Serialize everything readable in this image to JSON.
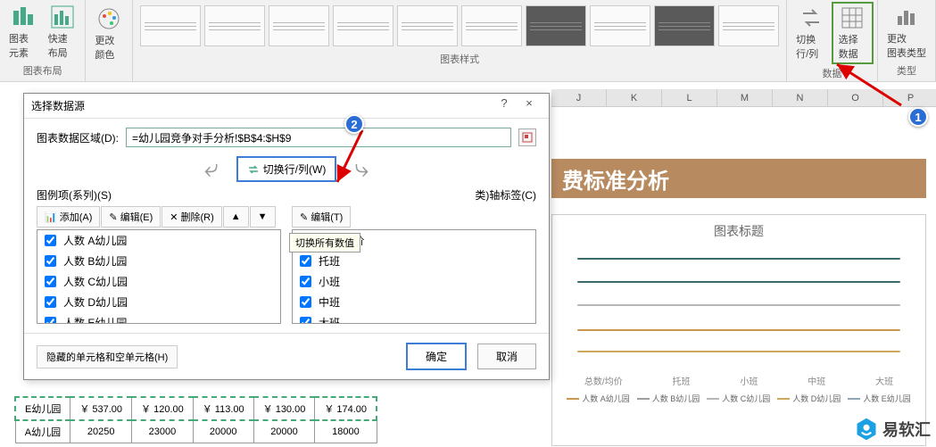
{
  "ribbon": {
    "groups": {
      "layout": {
        "label": "图表布局",
        "btns": [
          {
            "id": "add-element",
            "label": "图表元素"
          },
          {
            "id": "quick-layout",
            "label": "快速布局"
          }
        ]
      },
      "color": {
        "btn": {
          "id": "change-color",
          "label": "更改颜色"
        }
      },
      "styles": {
        "label": "图表样式"
      },
      "data": {
        "label": "数据",
        "btns": [
          {
            "id": "switch-rowcol",
            "label": "切换行/列"
          },
          {
            "id": "select-data",
            "label": "选择数据"
          }
        ]
      },
      "type": {
        "label": "类型",
        "btn": {
          "id": "change-type",
          "label": "更改\n图表类型"
        }
      }
    }
  },
  "columns": [
    "J",
    "K",
    "L",
    "M",
    "N",
    "O",
    "P"
  ],
  "banner": {
    "title": "费标准分析"
  },
  "chart": {
    "title": "图表标题",
    "categories": [
      "总数/均价",
      "托班",
      "小班",
      "中班",
      "大班"
    ],
    "legend": [
      "人数 A幼儿园",
      "人数 B幼儿园",
      "人数 C幼儿园",
      "人数 D幼儿园",
      "人数 E幼儿园"
    ],
    "colors": [
      "#c9974e",
      "#9aa19a",
      "#b7b7b7",
      "#cba85e",
      "#8fa7b3"
    ]
  },
  "chart_data": {
    "type": "line",
    "categories": [
      "总数/均价",
      "托班",
      "小班",
      "中班",
      "大班"
    ],
    "series": [
      {
        "name": "人数 A幼儿园",
        "values": [
          null,
          null,
          null,
          null,
          null
        ]
      },
      {
        "name": "人数 B幼儿园",
        "values": [
          null,
          null,
          null,
          null,
          null
        ]
      },
      {
        "name": "人数 C幼儿园",
        "values": [
          null,
          null,
          null,
          null,
          null
        ]
      },
      {
        "name": "人数 D幼儿园",
        "values": [
          null,
          null,
          null,
          null,
          null
        ]
      },
      {
        "name": "人数 E幼儿园",
        "values": [
          null,
          null,
          null,
          null,
          null
        ]
      }
    ],
    "title": "图表标题"
  },
  "table": {
    "rows": [
      [
        "E幼儿园",
        "￥ 537.00",
        "￥ 120.00",
        "￥ 113.00",
        "￥ 130.00",
        "￥ 174.00"
      ],
      [
        "A幼儿园",
        "20250",
        "23000",
        "20000",
        "20000",
        "18000"
      ]
    ]
  },
  "dialog": {
    "title": "选择数据源",
    "helpChar": "?",
    "closeChar": "×",
    "rangeLabel": "图表数据区域(D):",
    "rangeValue": "=幼儿园竞争对手分析!$B$4:$H$9",
    "switchBtn": "切换行/列(W)",
    "tooltip": "切换所有数值",
    "legendLabel": "图例项(系列)(S)",
    "axisLabel": "类)轴标签(C)",
    "toolbar": {
      "add": "添加(A)",
      "edit": "编辑(E)",
      "remove": "删除(R)",
      "editAxis": "编辑(T)"
    },
    "series": [
      "人数 A幼儿园",
      "人数 B幼儿园",
      "人数 C幼儿园",
      "人数 D幼儿园",
      "人数 E幼儿园"
    ],
    "axisItems": [
      "总数/均价",
      "托班",
      "小班",
      "中班",
      "大班"
    ],
    "hiddenBtn": "隐藏的单元格和空单元格(H)",
    "ok": "确定",
    "cancel": "取消"
  },
  "annotations": {
    "one": "1",
    "two": "2"
  },
  "watermark": "易软汇"
}
